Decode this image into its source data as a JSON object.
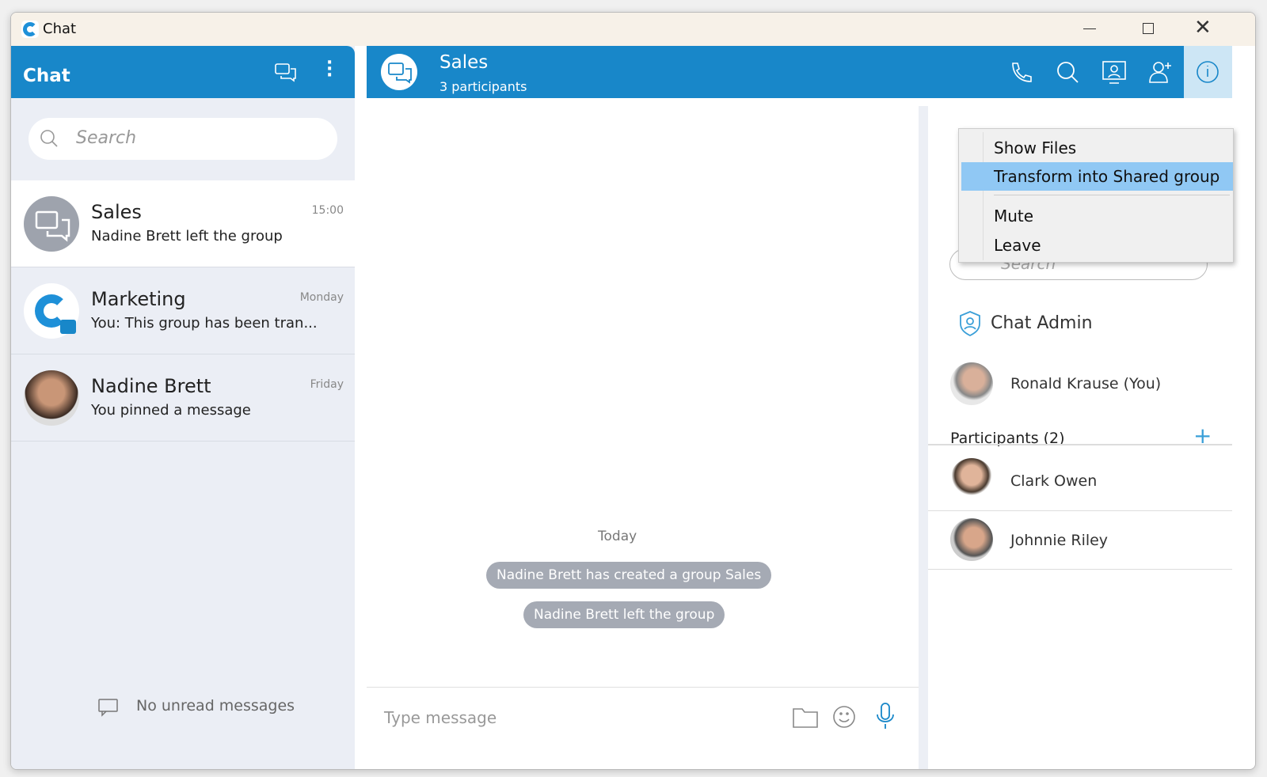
{
  "window": {
    "title": "Chat",
    "minimize_icon": "minimize-icon",
    "maximize_icon": "maximize-icon",
    "close_icon": "close-icon"
  },
  "sidebar": {
    "title": "Chat",
    "search_placeholder": "Search",
    "empty_text": "No unread messages",
    "conversations": [
      {
        "name": "Sales",
        "message": "Nadine Brett left the group",
        "time": "15:00"
      },
      {
        "name": "Marketing",
        "message": "You: This group has been tran...",
        "time": "Monday"
      },
      {
        "name": "Nadine Brett",
        "message": "You pinned a message",
        "time": "Friday"
      }
    ]
  },
  "chat": {
    "title": "Sales",
    "subtitle": "3 participants",
    "date_label": "Today",
    "events": [
      "Nadine Brett has created a group Sales",
      "Nadine Brett left the group"
    ],
    "input_placeholder": "Type message"
  },
  "menu": {
    "items": [
      "Show Files",
      "Transform into Shared group",
      "Mute",
      "Leave"
    ],
    "highlighted": "Transform into Shared group"
  },
  "info": {
    "search_placeholder": "Search",
    "admin_label": "Chat Admin",
    "admin": "Ronald Krause (You)",
    "participants_label": "Participants (2)",
    "participants": [
      "Clark Owen",
      "Johnnie Riley"
    ]
  },
  "colors": {
    "brand": "#1887c9",
    "highlight": "#90c8f4",
    "pill": "#a5aab4"
  }
}
